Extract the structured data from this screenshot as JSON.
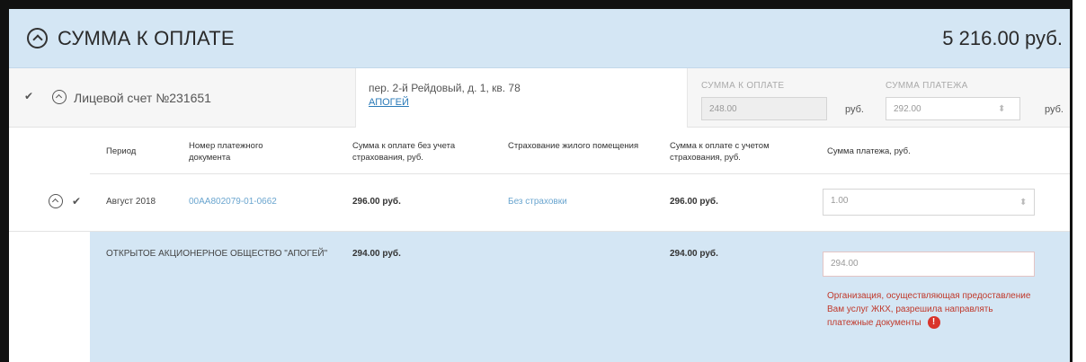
{
  "header": {
    "title": "СУММА К ОПЛАТЕ",
    "total": "5 216.00 руб."
  },
  "account": {
    "label": "Лицевой счет №231651",
    "address": "пер. 2-й Рейдовый, д. 1, кв. 78",
    "address_link": "АПОГЕЙ",
    "sum_caption": "СУММА К ОПЛАТЕ",
    "sum_value": "248.00",
    "sum_unit": "руб.",
    "payment_caption": "СУММА ПЛАТЕЖА",
    "payment_value": "292.00",
    "payment_unit": "руб."
  },
  "table": {
    "headers": [
      "Период",
      "Номер платежного документа",
      "Сумма к оплате без учета страхования, руб.",
      "Страхование жилого помещения",
      "Сумма к оплате с учетом страхования, руб.",
      "Сумма платежа, руб."
    ],
    "period_row": {
      "period": "Август 2018",
      "doc_number": "00AA802079-01-0662",
      "sum_without_ins": "296.00 руб.",
      "insurance": "Без страховки",
      "sum_with_ins": "296.00 руб.",
      "payment": "1.00"
    },
    "org_row": {
      "name": "ОТКРЫТОЕ АКЦИОНЕРНОЕ ОБЩЕСТВО \"АПОГЕЙ\"",
      "sum_without_ins": "294.00 руб.",
      "sum_with_ins": "294.00 руб.",
      "payment_placeholder": "294.00",
      "error_text": "Организация, осуществляющая предоставление Вам услуг ЖКХ, разрешила направлять платежные документы",
      "error_icon": "!"
    }
  },
  "colors": {
    "header_bg": "#d4e6f4",
    "error": "#c0392b",
    "link": "#2a7ab8"
  }
}
